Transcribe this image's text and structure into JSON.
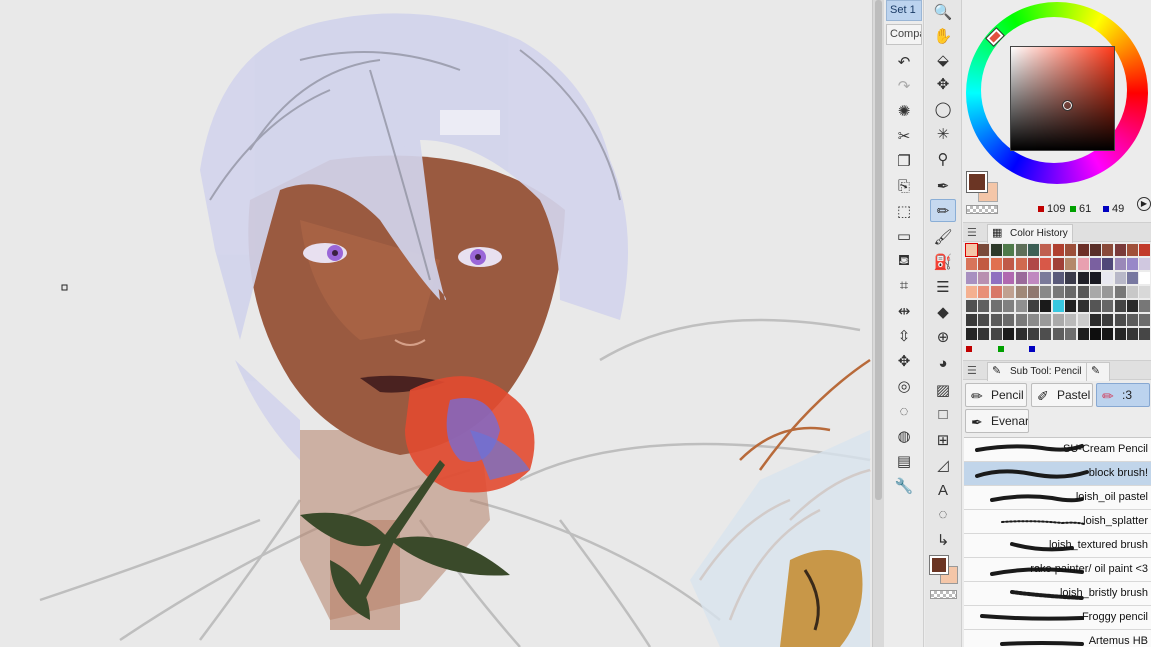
{
  "palette_sets": [
    {
      "label": "Set 1",
      "active": true
    },
    {
      "label": "Compa",
      "active": false
    }
  ],
  "colors": {
    "main": "#6b3524",
    "sub": "#f4c6a8",
    "accent": "#bcd3ee"
  },
  "rgb": {
    "r": "109",
    "g": "61",
    "b": "49"
  },
  "panels": {
    "color_history_tab": "Color History",
    "sub_tool_tab": "Sub Tool: Pencil"
  },
  "sub_tool_buttons": [
    {
      "label": "Pencil",
      "active": false
    },
    {
      "label": "Pastel",
      "active": false
    },
    {
      "label": ":3",
      "active": true
    },
    {
      "label": "Evenar",
      "active": false
    }
  ],
  "brushes": [
    {
      "name": "SU-Cream Pencil",
      "selected": false
    },
    {
      "name": "block brush!",
      "selected": true
    },
    {
      "name": "loish_oil pastel",
      "selected": false
    },
    {
      "name": "loish_splatter",
      "selected": false
    },
    {
      "name": "loish_textured brush",
      "selected": false
    },
    {
      "name": "rake painter/ oil paint <3",
      "selected": false
    },
    {
      "name": "loish_bristly brush",
      "selected": false
    },
    {
      "name": "Froggy pencil",
      "selected": false
    },
    {
      "name": "Artemus HB",
      "selected": false
    }
  ],
  "history_colors": [
    "#f4c6a8",
    "#7a4a3a",
    "#2e3a2a",
    "#4f7a4a",
    "#5e6f59",
    "#3c5f55",
    "#c06050",
    "#b04030",
    "#9c4f3a",
    "#6c2f28",
    "#5a2f28",
    "#8a4a3a",
    "#7a3a3a",
    "#a0503a",
    "#c23a2a",
    "#d8745a",
    "#c25a42",
    "#e07050",
    "#c05a48",
    "#d06a50",
    "#b04848",
    "#d85848",
    "#a04038",
    "#b4886a",
    "#e8a0b0",
    "#7a60a0",
    "#504878",
    "#9a88b8",
    "#9888c8",
    "#d0c8e0",
    "#a890c0",
    "#b890b0",
    "#9070c0",
    "#b068b0",
    "#9a6a9a",
    "#c088c0",
    "#7a7a9a",
    "#5a5a7a",
    "#3a3a4a",
    "#202028",
    "#1a1a22",
    "#e8e8f0",
    "#b8b8c8",
    "#7878a0",
    "#ffffff",
    "#f4b090",
    "#e89078",
    "#d87868",
    "#c0a090",
    "#a08878",
    "#907870",
    "#888888",
    "#787878",
    "#686868",
    "#585858",
    "#a8a8a8",
    "#989898",
    "#787878",
    "#c8c8c8",
    "#d8d8d8",
    "#505050",
    "#606060",
    "#707070",
    "#808080",
    "#909090",
    "#404040",
    "#1a1a1a",
    "#38c8e0",
    "#202020",
    "#303030",
    "#555555",
    "#666666",
    "#444444",
    "#2a2a2a",
    "#777777",
    "#3a3a3a",
    "#4a4a4a",
    "#5a5a5a",
    "#6a6a6a",
    "#7a7a7a",
    "#8a8a8a",
    "#9a9a9a",
    "#aaaaaa",
    "#bababa",
    "#cacaca",
    "#2c2c2c",
    "#3c3c3c",
    "#4c4c4c",
    "#5c5c5c",
    "#6c6c6c",
    "#252525",
    "#353535",
    "#454545",
    "#1c1c1c",
    "#2e2e2e",
    "#3e3e3e",
    "#4e4e4e",
    "#5e5e5e",
    "#6e6e6e",
    "#1e1e1e",
    "#0e0e0e",
    "#161616",
    "#262626",
    "#363636",
    "#464646"
  ],
  "icons": {
    "commands": [
      "undo-icon",
      "redo-icon",
      "clear-icon",
      "cut-icon",
      "copy-icon",
      "paste-icon",
      "transform-icon",
      "free-transform-icon",
      "fill-icon",
      "mesh-icon",
      "flip-h-icon",
      "flip-v-icon",
      "move-icon",
      "snap-icon",
      "ruler-icon",
      "ruler2-icon",
      "folder-icon",
      "wrench-icon"
    ],
    "tools": [
      "zoom-icon",
      "hand-icon",
      "layer-move-icon",
      "move-icon",
      "lasso-icon",
      "magic-wand-icon",
      "eyedropper-icon",
      "pen-icon",
      "pencil-icon",
      "brush-icon",
      "airbrush-icon",
      "blend-icon",
      "eraser-icon",
      "grid-icon",
      "fill-bucket-icon",
      "gradient-icon",
      "figure-icon",
      "frame-icon",
      "ruler-icon",
      "text-icon",
      "balloon-icon",
      "correct-line-icon"
    ]
  }
}
